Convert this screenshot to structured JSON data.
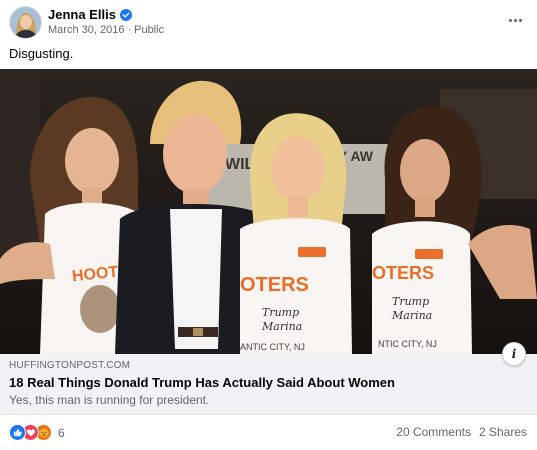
{
  "post": {
    "author": "Jenna Ellis",
    "date": "March 30, 2016",
    "separator": "·",
    "audience": "Public",
    "text": "Disgusting."
  },
  "link_preview": {
    "domain": "HUFFINGTONPOST.COM",
    "headline": "18 Real Things Donald Trump Has Actually Said About Women",
    "subline": "Yes, this man is running for president."
  },
  "photo": {
    "shirt_logo_text": "HOOTERS",
    "shirt_caption": "Trump Marina",
    "shirt_city": "ATLANTIC CITY, NJ"
  },
  "footer": {
    "reaction_count": "6",
    "comments": "20 Comments",
    "shares": "2 Shares"
  },
  "colors": {
    "accent": "#1877f2",
    "like": "#1877f2",
    "love": "#f33e58",
    "angry": "#e9710f",
    "hooters_orange": "#e8702a"
  }
}
